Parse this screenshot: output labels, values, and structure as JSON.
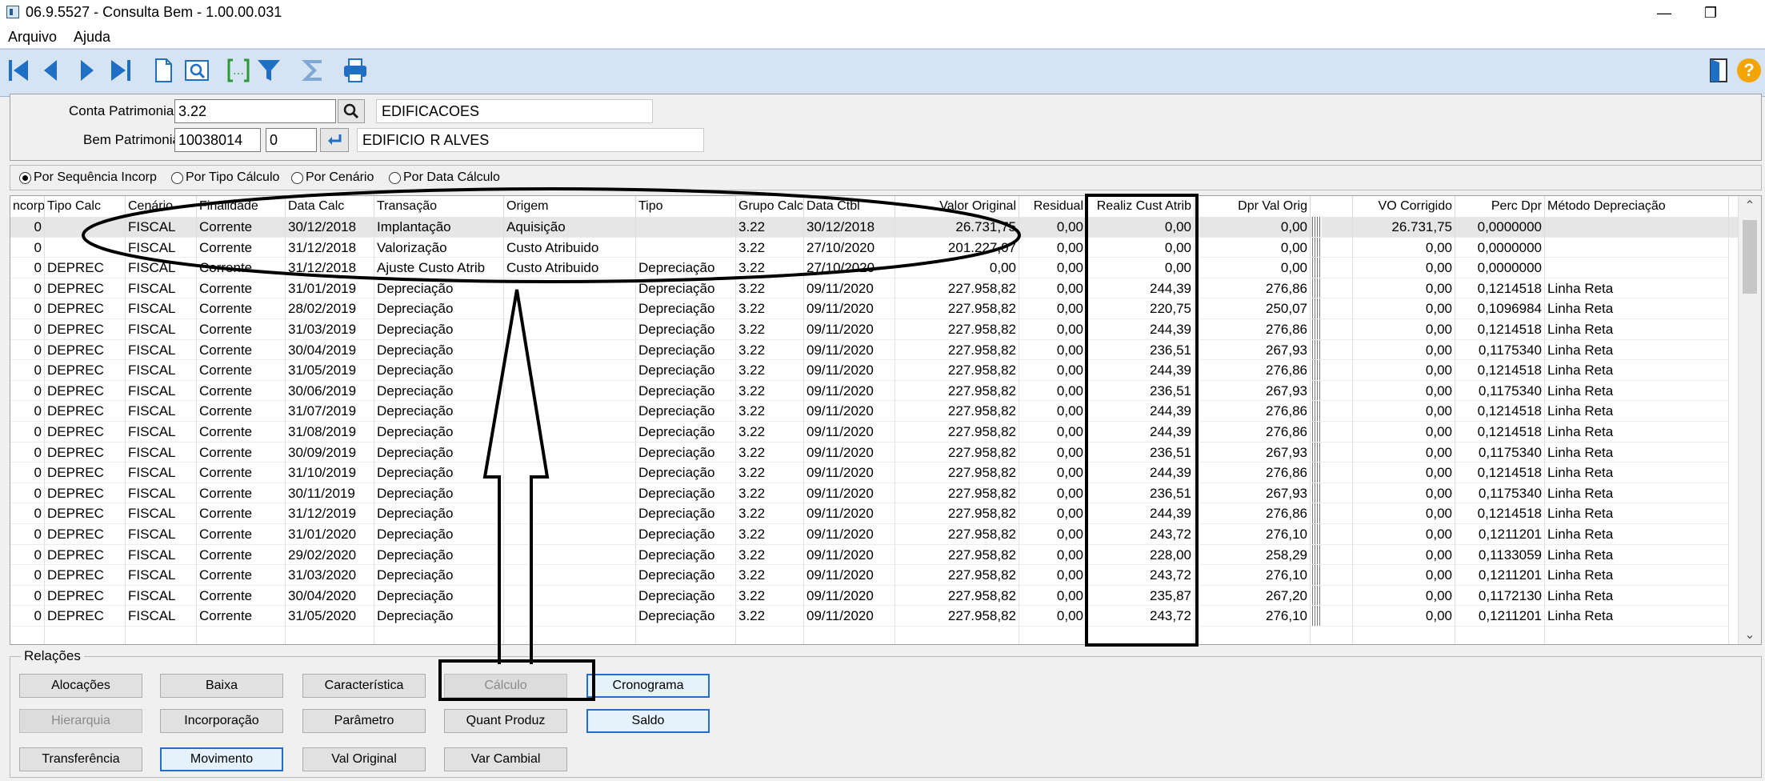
{
  "window": {
    "title": "06.9.5527 - Consulta Bem - 1.00.00.031",
    "minimize": "—",
    "restore": "❐",
    "close": "✕"
  },
  "menu": {
    "items": [
      {
        "label": "Arquivo"
      },
      {
        "label": "Ajuda"
      }
    ]
  },
  "toolbar": {
    "icons": [
      "first-record-icon",
      "previous-record-icon",
      "next-record-icon",
      "last-record-icon",
      "new-document-icon",
      "preview-icon",
      "bracket-filter-icon",
      "filter-icon",
      "sum-icon",
      "print-icon",
      "exit-door-icon",
      "help-icon"
    ],
    "help_glyph": "?"
  },
  "header": {
    "conta_label": "Conta Patrimonial:",
    "conta_value": "3.22",
    "conta_desc": "EDIFICACOES",
    "bem_label": "Bem Patrimonial:",
    "bem_value": "10038014",
    "bem_seq": "0",
    "bem_desc": "EDIFICIO  R ALVES"
  },
  "radios": [
    {
      "label": "Por Sequência Incorp",
      "checked": true
    },
    {
      "label": "Por Tipo Cálculo",
      "checked": false
    },
    {
      "label": "Por Cenário",
      "checked": false
    },
    {
      "label": "Por Data Cálculo",
      "checked": false
    }
  ],
  "grid": {
    "columns": [
      "ncorp",
      "Tipo Calc",
      "Cenário",
      "Finalidade",
      "Data Calc",
      "Transação",
      "Origem",
      "Tipo",
      "Grupo Calc",
      "Data Ctbl",
      "Valor Original",
      "Residual",
      "Realiz Cust Atrib",
      "Dpr Val Orig",
      "",
      "VO Corrigido",
      "Perc Dpr",
      "Método Depreciação"
    ],
    "rows": [
      [
        "0",
        "",
        "FISCAL",
        "Corrente",
        "30/12/2018",
        "Implantação",
        "Aquisição",
        "",
        "3.22",
        "30/12/2018",
        "26.731,75",
        "0,00",
        "0,00",
        "0,00",
        "26.731,75",
        "0,0000000",
        ""
      ],
      [
        "0",
        "",
        "FISCAL",
        "Corrente",
        "31/12/2018",
        "Valorização",
        "Custo Atribuido",
        "",
        "3.22",
        "27/10/2020",
        "201.227,07",
        "0,00",
        "0,00",
        "0,00",
        "0,00",
        "0,0000000",
        ""
      ],
      [
        "0",
        "DEPREC",
        "FISCAL",
        "Corrente",
        "31/12/2018",
        "Ajuste Custo Atrib",
        "Custo Atribuido",
        "Depreciação",
        "3.22",
        "27/10/2020",
        "0,00",
        "0,00",
        "0,00",
        "0,00",
        "0,00",
        "0,0000000",
        ""
      ],
      [
        "0",
        "DEPREC",
        "FISCAL",
        "Corrente",
        "31/01/2019",
        "Depreciação",
        "",
        "Depreciação",
        "3.22",
        "09/11/2020",
        "227.958,82",
        "0,00",
        "244,39",
        "276,86",
        "0,00",
        "0,1214518",
        "Linha Reta"
      ],
      [
        "0",
        "DEPREC",
        "FISCAL",
        "Corrente",
        "28/02/2019",
        "Depreciação",
        "",
        "Depreciação",
        "3.22",
        "09/11/2020",
        "227.958,82",
        "0,00",
        "220,75",
        "250,07",
        "0,00",
        "0,1096984",
        "Linha Reta"
      ],
      [
        "0",
        "DEPREC",
        "FISCAL",
        "Corrente",
        "31/03/2019",
        "Depreciação",
        "",
        "Depreciação",
        "3.22",
        "09/11/2020",
        "227.958,82",
        "0,00",
        "244,39",
        "276,86",
        "0,00",
        "0,1214518",
        "Linha Reta"
      ],
      [
        "0",
        "DEPREC",
        "FISCAL",
        "Corrente",
        "30/04/2019",
        "Depreciação",
        "",
        "Depreciação",
        "3.22",
        "09/11/2020",
        "227.958,82",
        "0,00",
        "236,51",
        "267,93",
        "0,00",
        "0,1175340",
        "Linha Reta"
      ],
      [
        "0",
        "DEPREC",
        "FISCAL",
        "Corrente",
        "31/05/2019",
        "Depreciação",
        "",
        "Depreciação",
        "3.22",
        "09/11/2020",
        "227.958,82",
        "0,00",
        "244,39",
        "276,86",
        "0,00",
        "0,1214518",
        "Linha Reta"
      ],
      [
        "0",
        "DEPREC",
        "FISCAL",
        "Corrente",
        "30/06/2019",
        "Depreciação",
        "",
        "Depreciação",
        "3.22",
        "09/11/2020",
        "227.958,82",
        "0,00",
        "236,51",
        "267,93",
        "0,00",
        "0,1175340",
        "Linha Reta"
      ],
      [
        "0",
        "DEPREC",
        "FISCAL",
        "Corrente",
        "31/07/2019",
        "Depreciação",
        "",
        "Depreciação",
        "3.22",
        "09/11/2020",
        "227.958,82",
        "0,00",
        "244,39",
        "276,86",
        "0,00",
        "0,1214518",
        "Linha Reta"
      ],
      [
        "0",
        "DEPREC",
        "FISCAL",
        "Corrente",
        "31/08/2019",
        "Depreciação",
        "",
        "Depreciação",
        "3.22",
        "09/11/2020",
        "227.958,82",
        "0,00",
        "244,39",
        "276,86",
        "0,00",
        "0,1214518",
        "Linha Reta"
      ],
      [
        "0",
        "DEPREC",
        "FISCAL",
        "Corrente",
        "30/09/2019",
        "Depreciação",
        "",
        "Depreciação",
        "3.22",
        "09/11/2020",
        "227.958,82",
        "0,00",
        "236,51",
        "267,93",
        "0,00",
        "0,1175340",
        "Linha Reta"
      ],
      [
        "0",
        "DEPREC",
        "FISCAL",
        "Corrente",
        "31/10/2019",
        "Depreciação",
        "",
        "Depreciação",
        "3.22",
        "09/11/2020",
        "227.958,82",
        "0,00",
        "244,39",
        "276,86",
        "0,00",
        "0,1214518",
        "Linha Reta"
      ],
      [
        "0",
        "DEPREC",
        "FISCAL",
        "Corrente",
        "30/11/2019",
        "Depreciação",
        "",
        "Depreciação",
        "3.22",
        "09/11/2020",
        "227.958,82",
        "0,00",
        "236,51",
        "267,93",
        "0,00",
        "0,1175340",
        "Linha Reta"
      ],
      [
        "0",
        "DEPREC",
        "FISCAL",
        "Corrente",
        "31/12/2019",
        "Depreciação",
        "",
        "Depreciação",
        "3.22",
        "09/11/2020",
        "227.958,82",
        "0,00",
        "244,39",
        "276,86",
        "0,00",
        "0,1214518",
        "Linha Reta"
      ],
      [
        "0",
        "DEPREC",
        "FISCAL",
        "Corrente",
        "31/01/2020",
        "Depreciação",
        "",
        "Depreciação",
        "3.22",
        "09/11/2020",
        "227.958,82",
        "0,00",
        "243,72",
        "276,10",
        "0,00",
        "0,1211201",
        "Linha Reta"
      ],
      [
        "0",
        "DEPREC",
        "FISCAL",
        "Corrente",
        "29/02/2020",
        "Depreciação",
        "",
        "Depreciação",
        "3.22",
        "09/11/2020",
        "227.958,82",
        "0,00",
        "228,00",
        "258,29",
        "0,00",
        "0,1133059",
        "Linha Reta"
      ],
      [
        "0",
        "DEPREC",
        "FISCAL",
        "Corrente",
        "31/03/2020",
        "Depreciação",
        "",
        "Depreciação",
        "3.22",
        "09/11/2020",
        "227.958,82",
        "0,00",
        "243,72",
        "276,10",
        "0,00",
        "0,1211201",
        "Linha Reta"
      ],
      [
        "0",
        "DEPREC",
        "FISCAL",
        "Corrente",
        "30/04/2020",
        "Depreciação",
        "",
        "Depreciação",
        "3.22",
        "09/11/2020",
        "227.958,82",
        "0,00",
        "235,87",
        "267,20",
        "0,00",
        "0,1172130",
        "Linha Reta"
      ],
      [
        "0",
        "DEPREC",
        "FISCAL",
        "Corrente",
        "31/05/2020",
        "Depreciação",
        "",
        "Depreciação",
        "3.22",
        "09/11/2020",
        "227.958,82",
        "0,00",
        "243,72",
        "276,10",
        "0,00",
        "0,1211201",
        "Linha Reta"
      ]
    ],
    "scroll_up": "⌃",
    "scroll_down": "⌄"
  },
  "relations": {
    "title": "Relações",
    "buttons": [
      {
        "label": "Alocações",
        "state": "normal"
      },
      {
        "label": "Baixa",
        "state": "normal"
      },
      {
        "label": "Característica",
        "state": "normal"
      },
      {
        "label": "Cálculo",
        "state": "disabled"
      },
      {
        "label": "Cronograma",
        "state": "focus"
      },
      {
        "label": "Hierarquia",
        "state": "disabled"
      },
      {
        "label": "Incorporação",
        "state": "normal"
      },
      {
        "label": "Parâmetro",
        "state": "normal"
      },
      {
        "label": "Quant Produz",
        "state": "normal"
      },
      {
        "label": "Saldo",
        "state": "focus"
      },
      {
        "label": "Transferência",
        "state": "normal"
      },
      {
        "label": "Movimento",
        "state": "focus"
      },
      {
        "label": "Val Original",
        "state": "normal"
      },
      {
        "label": "Var Cambial",
        "state": "normal"
      }
    ]
  },
  "colors": {
    "toolbar_bg": "#d6e3f2",
    "icon_blue": "#1f6fc5",
    "focus_border": "#1e6fd0"
  }
}
